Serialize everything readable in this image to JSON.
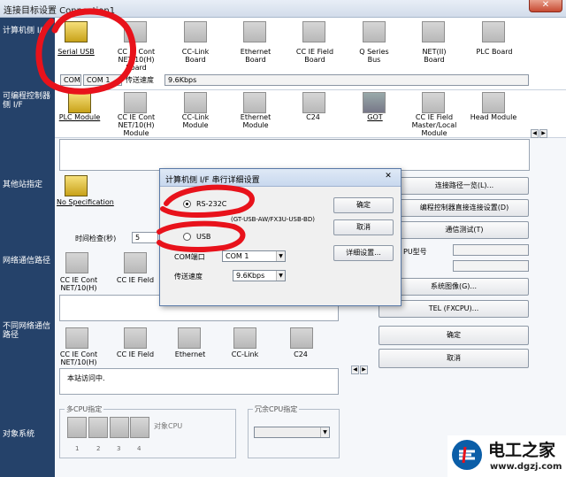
{
  "window": {
    "title": "连接目标设置 Connection1",
    "close_label": "✕"
  },
  "sections": {
    "pc_if": "计算机侧 I/F",
    "plc_if": "可编程控制器侧 I/F",
    "other_station": "其他站指定",
    "network_route": "网络通信路径",
    "diff_network": "不同网络通信路径",
    "target_system": "对象系统"
  },
  "pc_if_options": [
    {
      "label": "Serial USB",
      "selected": true
    },
    {
      "label": "CC IE Cont NET/10(H) Board"
    },
    {
      "label": "CC-Link Board"
    },
    {
      "label": "Ethernet Board"
    },
    {
      "label": "CC IE Field Board"
    },
    {
      "label": "Q Series Bus"
    },
    {
      "label": "NET(II) Board"
    },
    {
      "label": "PLC Board"
    }
  ],
  "pc_if_status": {
    "com_label": "COM",
    "com_value": "COM 1",
    "speed_label": "传送速度",
    "speed_value": "9.6Kbps"
  },
  "plc_if_options": [
    {
      "label": "PLC Module",
      "selected": true
    },
    {
      "label": "CC IE Cont NET/10(H) Module"
    },
    {
      "label": "CC-Link Module"
    },
    {
      "label": "Ethernet Module"
    },
    {
      "label": "C24"
    },
    {
      "label": "GOT"
    },
    {
      "label": "CC IE Field Master/Local Module"
    },
    {
      "label": "Head Module"
    }
  ],
  "other_station": {
    "option_label": "No Specification",
    "time_check_label": "时间检查(秒)",
    "time_check_value": "5"
  },
  "network_route_options": [
    {
      "label": "CC IE Cont NET/10(H)"
    },
    {
      "label": "CC IE Field"
    }
  ],
  "diff_network_options": [
    {
      "label": "CC IE Cont NET/10(H)"
    },
    {
      "label": "CC IE Field"
    },
    {
      "label": "Ethernet"
    },
    {
      "label": "CC-Link"
    },
    {
      "label": "C24"
    }
  ],
  "status_text": "本站访问中.",
  "right_buttons": {
    "route_list": "连接路径一览(L)...",
    "direct_connect": "编程控制器直接连接设置(D)",
    "comm_test": "通信测试(T)",
    "cpu_type_label": "PU型号",
    "system_image": "系统图像(G)...",
    "tel": "TEL (FXCPU)...",
    "ok": "确定",
    "cancel": "取消"
  },
  "multi_cpu": {
    "title": "多CPU指定",
    "target_cpu_label": "对象CPU",
    "numbers": [
      "1",
      "2",
      "3",
      "4"
    ],
    "redundant_title": "冗余CPU指定"
  },
  "dialog": {
    "title": "计算机侧 I/F 串行详细设置",
    "close_label": "✕",
    "radio_rs232c": "RS-232C",
    "usb_note": "(GT-USB-AW/FX3U-USB-BD)",
    "radio_usb": "USB",
    "com_port_label": "COM端口",
    "com_port_value": "COM 1",
    "speed_label": "传送速度",
    "speed_value": "9.6Kbps",
    "ok": "确定",
    "cancel": "取消",
    "detail": "详细设置..."
  },
  "watermark": {
    "brand": "电工之家",
    "url": "www.dgzj.com"
  },
  "colors": {
    "sidebar": "#25426a",
    "annotation": "#e8121b",
    "selected_icon": "#e0c040"
  }
}
